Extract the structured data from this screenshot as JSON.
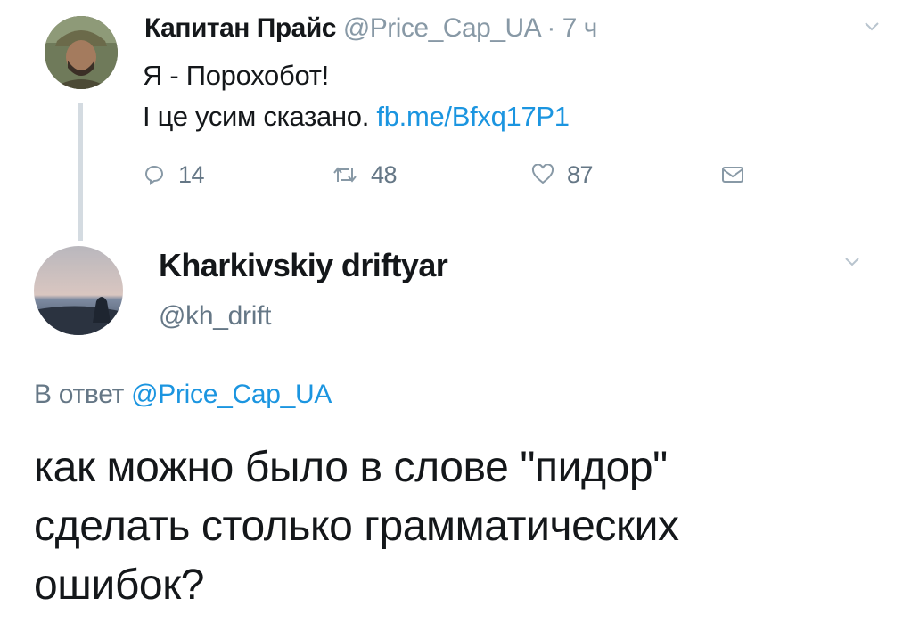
{
  "original_tweet": {
    "author_name": "Капитан Прайс",
    "handle": "@Price_Cap_UA",
    "separator": "·",
    "time": "7 ч",
    "text_lines": [
      "Я - Порохобот!",
      "І це усим сказано."
    ],
    "link": "fb.me/Bfxq17P1",
    "actions": {
      "replies": "14",
      "retweets": "48",
      "likes": "87"
    },
    "icons": [
      "chevron-down-icon",
      "reply-icon",
      "retweet-icon",
      "like-icon",
      "message-icon"
    ]
  },
  "reply_tweet": {
    "author_name": "Kharkivskiy driftyar",
    "handle": "@kh_drift",
    "reply_prefix": "В ответ",
    "reply_mention": "@Price_Cap_UA",
    "text_lines": [
      "как можно было в слове \"пидор\"",
      "сделать столько грамматических",
      "ошибок?"
    ],
    "icons": [
      "chevron-down-icon"
    ]
  },
  "colors": {
    "link": "#1b95e0",
    "muted": "#657786",
    "text": "#14171a",
    "thread_line": "#d4dbe1"
  }
}
